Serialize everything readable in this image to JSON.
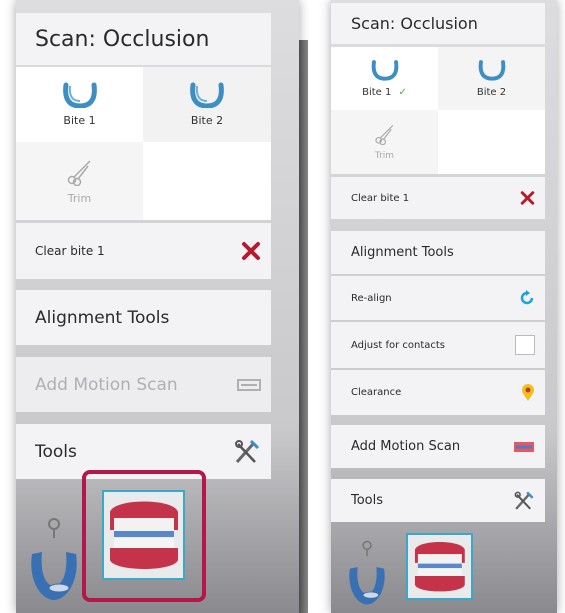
{
  "left_panel": {
    "title": "Scan: Occlusion",
    "bite1": "Bite 1",
    "bite2": "Bite 2",
    "trim": "Trim",
    "clear_bite": "Clear bite 1",
    "alignment_tools": "Alignment Tools",
    "add_motion_scan": "Add Motion Scan",
    "tools": "Tools"
  },
  "right_panel": {
    "title": "Scan: Occlusion",
    "bite1": "Bite 1",
    "bite2": "Bite 2",
    "trim": "Trim",
    "clear_bite": "Clear bite 1",
    "alignment_tools": "Alignment Tools",
    "realign": "Re-align",
    "adjust_contacts": "Adjust for contacts",
    "clearance": "Clearance",
    "add_motion_scan": "Add Motion Scan",
    "tools": "Tools"
  },
  "colors": {
    "accent_blue": "#3e8ec4",
    "delete_red": "#b31c2c",
    "check_green": "#4caf50",
    "highlight_magenta": "#b4174a",
    "selection_teal": "#3aa9c9"
  },
  "icons": {
    "arch": "upper-arch-icon",
    "scissors": "scissors-icon",
    "close": "close-x-icon",
    "realign": "refresh-icon",
    "clearance": "location-pin-icon",
    "motion": "motion-scan-icon",
    "tools": "tools-icon"
  }
}
